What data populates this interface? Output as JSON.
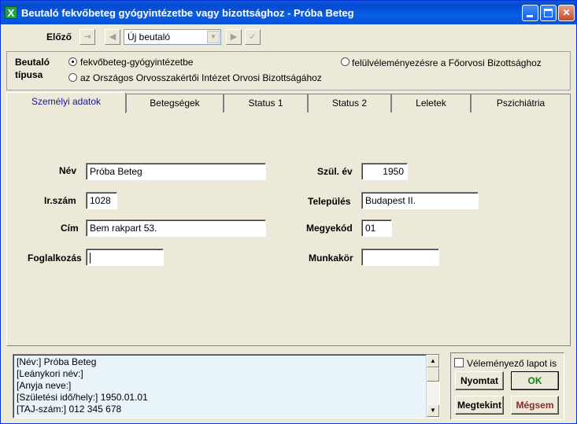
{
  "window": {
    "title": "Beutaló fekvőbeteg gyógyintézetbe vagy bizottsághoz  -  Próba Beteg",
    "app_icon": "X"
  },
  "nav": {
    "prev_label": "Előző",
    "dropdown_value": "Új beutaló"
  },
  "referral_type": {
    "label_line1": "Beutaló",
    "label_line2": "típusa",
    "options": [
      {
        "label": "fekvőbeteg-gyógyintézetbe",
        "checked": true
      },
      {
        "label": "az Országos Orvosszakértői Intézet Orvosi Bizottságához",
        "checked": false
      },
      {
        "label": "felülvéleményezésre a Főorvosi Bizottsághoz",
        "checked": false
      }
    ]
  },
  "tabs": [
    {
      "label": "Személyi adatok",
      "active": true
    },
    {
      "label": "Betegségek",
      "active": false
    },
    {
      "label": "Status 1",
      "active": false
    },
    {
      "label": "Status 2",
      "active": false
    },
    {
      "label": "Leletek",
      "active": false
    },
    {
      "label": "Pszichiátria",
      "active": false
    }
  ],
  "form": {
    "name_label": "Név",
    "name_value": "Próba Beteg",
    "birth_year_label": "Szül. év",
    "birth_year_value": "1950",
    "zip_label": "Ir.szám",
    "zip_value": "1028",
    "city_label": "Település",
    "city_value": "Budapest II.",
    "address_label": "Cím",
    "address_value": "Bem rakpart 53.",
    "county_label": "Megyekód",
    "county_value": "01",
    "occupation_label": "Foglalkozás",
    "occupation_value": "",
    "job_label": "Munkakör",
    "job_value": ""
  },
  "memo": {
    "lines": [
      "[Név:]  Próba Beteg",
      "[Leánykori név:]",
      "[Anyja neve:]",
      "[Születési idő/hely:]  1950.01.01",
      "[TAJ-szám:]  012 345 678"
    ]
  },
  "actions": {
    "checkbox_label": "Véleményező lapot is",
    "print_label": "Nyomtat",
    "ok_label": "OK",
    "preview_label": "Megtekint",
    "cancel_label": "Mégsem"
  }
}
